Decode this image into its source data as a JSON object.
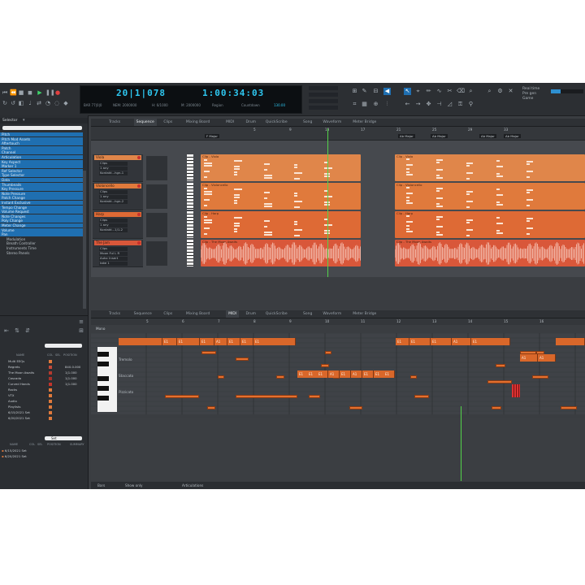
{
  "transport": {
    "bars_beats": "20|1|078",
    "time": "1:00:34:03",
    "sub_left": [
      "BAR 77|0|0",
      "NEM: 2000000"
    ],
    "sub_right": [
      "H: 6/1000",
      "M: 2000000"
    ],
    "region_label": "Region",
    "countdown_label": "Countdown",
    "tempo": "130.00"
  },
  "right_panel": [
    "Real time",
    "Pre gen",
    "Game"
  ],
  "tabs_top": [
    "Tracks",
    "Sequence",
    "Clips",
    "Mixing Board",
    "MIDI",
    "Drum",
    "QuickScribe",
    "Song",
    "Waveform",
    "Meter Bridge"
  ],
  "tabs_top_active": "Sequence",
  "tabs_bottom": [
    "Tracks",
    "Sequence",
    "Clips",
    "Mixing Board",
    "MIDI",
    "Drum",
    "QuickScribe",
    "Song",
    "Waveform",
    "Meter Bridge"
  ],
  "tabs_bottom_active": "MIDI",
  "browser": {
    "title": "Selector",
    "items": [
      "Pitch",
      "Pitch Mod Assets",
      "Aftertouch",
      "Patch",
      "Channel",
      "Articulation",
      "Key Aspect",
      "Marker 1",
      "Ref Selector",
      "Type Selector",
      "Data",
      "Thumbnails",
      "Key Pressure",
      "Note Pressure",
      "Patch Change",
      "Instant Exclusive",
      "Tempo Change",
      "Volume Request",
      "Note Changes",
      "Poly Change",
      "Meter Change",
      "Volume",
      "Pan"
    ],
    "items_dim": [
      "Modulation",
      "Breath Controller",
      "Instruments Time",
      "Stereo Panels"
    ],
    "list_headers": [
      "NAME",
      "COL",
      "SEL",
      "POSITION"
    ],
    "list_items": [
      {
        "name": "Multi EEQs",
        "pos": ""
      },
      {
        "name": "Regrets",
        "pos": "840.0.000"
      },
      {
        "name": "The Moon Awaits",
        "pos": "1|1.000"
      },
      {
        "name": "Cascada",
        "pos": "1|1.000"
      },
      {
        "name": "Curved Hands",
        "pos": "1|1.000"
      },
      {
        "name": "Racks",
        "pos": ""
      },
      {
        "name": "VTX",
        "pos": ""
      },
      {
        "name": "Audio",
        "pos": ""
      },
      {
        "name": "Playlists",
        "pos": ""
      },
      {
        "name": "6/15/2021 Set",
        "pos": ""
      },
      {
        "name": "6/20/2021 Set",
        "pos": ""
      }
    ],
    "search_value": "Set",
    "list2_headers": [
      "NAME",
      "COL",
      "SEL",
      "POSITION",
      "SUMMARY"
    ],
    "list2_items": [
      {
        "name": "6/15/2021 Set"
      },
      {
        "name": "6/20/2021 Set"
      }
    ]
  },
  "markers": [
    "F Major",
    "Ab Major",
    "Ab Major",
    "Ab Major",
    "Ab Major"
  ],
  "ruler_top": [
    "5",
    "9",
    "13",
    "17",
    "21",
    "25",
    "29",
    "33"
  ],
  "tracks": [
    {
      "name": "Viola",
      "fields": [
        "Clips",
        "1 any",
        "Kontakt...hgn-1"
      ],
      "clip1": "Clip - Viola",
      "clip2": "Clip - Viola",
      "color": "#e0864a"
    },
    {
      "name": "Violoncello",
      "fields": [
        "Clips",
        "1 any",
        "Kontakt...hgn-2"
      ],
      "clip1": "Clip - Violoncello",
      "clip2": "Clip - Violoncello",
      "color": "#e07a3c"
    },
    {
      "name": "Harp",
      "fields": [
        "Clips",
        "1 any",
        "Kontakt...1/1-2"
      ],
      "clip1": "Clip - Harp",
      "clip2": "Clip - Harp",
      "color": "#de6a35"
    },
    {
      "name": "The Jam",
      "fields": [
        "Clips",
        "Moon Ful L R",
        "Auto: Insert",
        "take 1"
      ],
      "clip1": "Clip - The Moon Awaits",
      "clip2": "Clip - The Moon Awaits",
      "color": "#d9573a"
    }
  ],
  "track_labels": {
    "transpose": "Transpose",
    "delay": "Delay",
    "auto": "Auto",
    "insert": "Insert",
    "wave": "Ready2 0\nAm Loom"
  },
  "ruler_bottom": [
    "5",
    "6",
    "7",
    "8",
    "9",
    "10",
    "11",
    "12",
    "13",
    "14",
    "15",
    "16"
  ],
  "piano_header": "Mono",
  "articulations": {
    "rows": [
      "Legato",
      "Tremolo",
      "Staccato",
      "Pizzicato"
    ],
    "legato": [
      "E1",
      "E1",
      "E1",
      "A1",
      "E1",
      "E1",
      "E1",
      "E1",
      "E1",
      "E1",
      "A1",
      "E1"
    ],
    "tremolo": [
      "A1",
      "A1"
    ],
    "staccato": [
      "E1",
      "E1",
      "E1",
      "A1",
      "E1",
      "A1",
      "E1",
      "E1",
      "E1"
    ]
  },
  "bottom_bar": {
    "items": [
      "Bars",
      "Show only",
      "Articulations"
    ]
  }
}
